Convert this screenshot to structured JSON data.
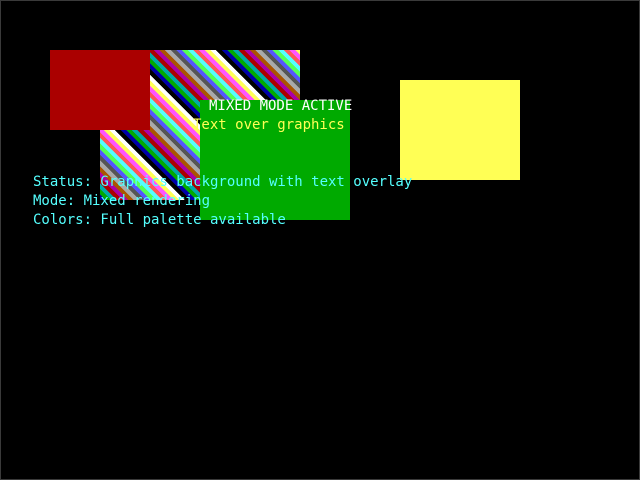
{
  "colors": {
    "background": "#000000",
    "red": "#aa0000",
    "green": "#00aa00",
    "yellow": "#ffff55",
    "title_text": "#ffffff",
    "subtitle_text": "#ffff55",
    "info_text": "#55ffff"
  },
  "overlay": {
    "title": "MIXED MODE ACTIVE",
    "subtitle": "Text over graphics"
  },
  "info": {
    "status": "Status: Graphics background with text overlay",
    "mode": "Mode: Mixed rendering",
    "colors": "Colors: Full palette available"
  }
}
